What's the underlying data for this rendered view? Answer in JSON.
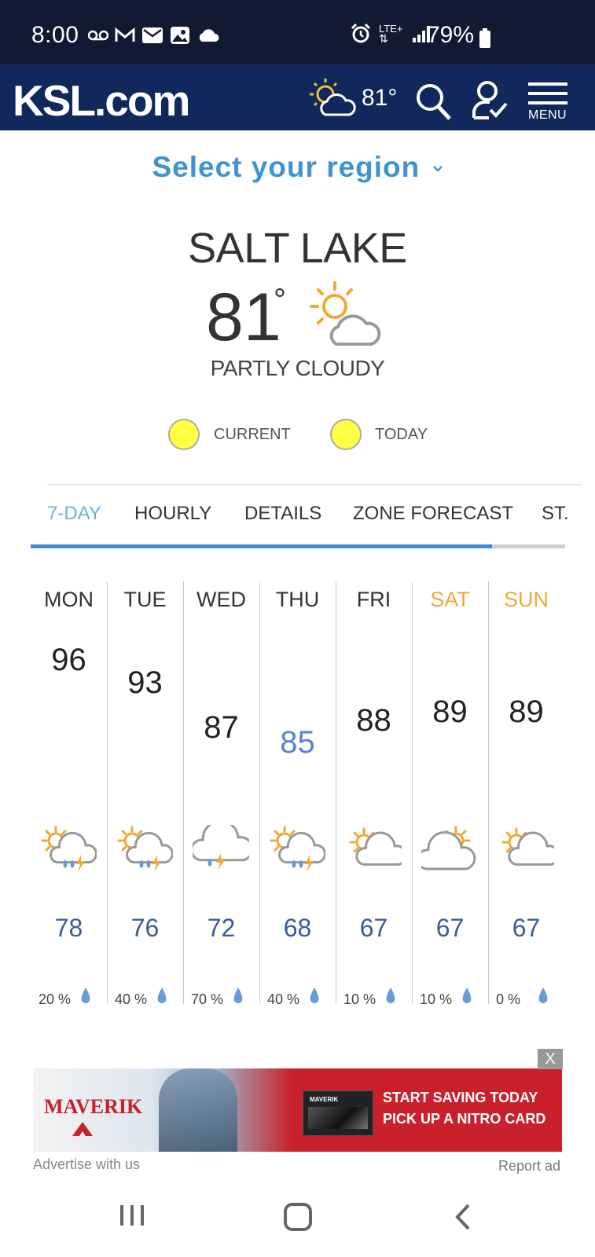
{
  "status_bar": {
    "time": "8:00",
    "network": "LTE+",
    "battery": "79%",
    "icons": [
      "voicemail-icon",
      "gmail-icon",
      "mail-icon",
      "image-icon",
      "cloud-icon",
      "alarm-icon",
      "signal-icon",
      "battery-icon"
    ]
  },
  "header": {
    "logo": "KSL.com",
    "temp": "81°",
    "menu_label": "MENU",
    "icons": [
      "partly-cloudy-icon",
      "search-icon",
      "account-icon",
      "menu-icon"
    ],
    "bg_color": "#10285c"
  },
  "region_selector": {
    "label": "Select your region"
  },
  "current": {
    "city": "SALT LAKE",
    "temp": "81",
    "degree": "°",
    "condition": "PARTLY CLOUDY"
  },
  "legend": [
    {
      "label": "CURRENT",
      "color": "#ffff44"
    },
    {
      "label": "TODAY",
      "color": "#ffff44"
    }
  ],
  "tabs": [
    {
      "label": "7-DAY",
      "active": true
    },
    {
      "label": "HOURLY",
      "active": false
    },
    {
      "label": "DETAILS",
      "active": false
    },
    {
      "label": "ZONE FORECAST",
      "active": false
    },
    {
      "label": "ST.",
      "active": false
    }
  ],
  "forecast": [
    {
      "day": "MON",
      "high": "96",
      "low": "78",
      "precip": "20 %",
      "icon": "sun-cloud-thunder-rain-icon",
      "weekend": false,
      "high_color": "#222222"
    },
    {
      "day": "TUE",
      "high": "93",
      "low": "76",
      "precip": "40 %",
      "icon": "sun-cloud-thunder-rain-icon",
      "weekend": false,
      "high_color": "#222222"
    },
    {
      "day": "WED",
      "high": "87",
      "low": "72",
      "precip": "70 %",
      "icon": "cloud-thunder-rain-icon",
      "weekend": false,
      "high_color": "#222222"
    },
    {
      "day": "THU",
      "high": "85",
      "low": "68",
      "precip": "40 %",
      "icon": "sun-cloud-thunder-rain-icon",
      "weekend": false,
      "high_color": "#5b82d1"
    },
    {
      "day": "FRI",
      "high": "88",
      "low": "67",
      "precip": "10 %",
      "icon": "partly-cloudy-icon",
      "weekend": false,
      "high_color": "#222222"
    },
    {
      "day": "SAT",
      "high": "89",
      "low": "67",
      "precip": "10 %",
      "icon": "mostly-cloudy-icon",
      "weekend": true,
      "high_color": "#222222"
    },
    {
      "day": "SUN",
      "high": "89",
      "low": "67",
      "precip": "0 %",
      "icon": "partly-cloudy-icon",
      "weekend": true,
      "high_color": "#222222"
    }
  ],
  "ad": {
    "brand": "MAVERIK",
    "card_text": "MAVERIK",
    "line1": "START SAVING TODAY",
    "line2": "PICK UP A NITRO CARD",
    "close": "X",
    "advertise": "Advertise with us",
    "report": "Report ad"
  },
  "nav": {
    "icons": [
      "recent-apps-icon",
      "home-icon",
      "back-icon"
    ]
  },
  "colors": {
    "accent": "#3f93d0",
    "weekend": "#f0a836",
    "low": "#3d5b96",
    "sun": "#f0a836"
  }
}
